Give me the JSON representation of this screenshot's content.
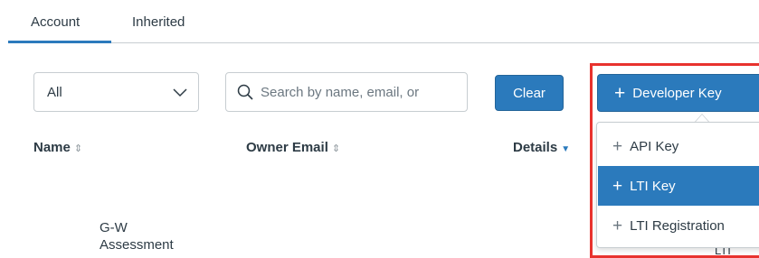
{
  "tabs": [
    {
      "label": "Account",
      "active": true
    },
    {
      "label": "Inherited",
      "active": false
    }
  ],
  "filter": {
    "selected": "All"
  },
  "search": {
    "placeholder": "Search by name, email, or"
  },
  "buttons": {
    "clear": "Clear",
    "developer_key": "Developer Key"
  },
  "table": {
    "headers": {
      "name": "Name",
      "owner_email": "Owner Email",
      "details": "Details"
    },
    "sort_glyph": "⇕",
    "active_sort_glyph": "▼",
    "row1": {
      "name_line1": "G-W",
      "name_line2": "Assessment",
      "details_partial": "LTI"
    }
  },
  "menu": {
    "items": [
      {
        "label": "API Key",
        "active": false
      },
      {
        "label": "LTI Key",
        "active": true
      },
      {
        "label": "LTI Registration",
        "active": false
      }
    ]
  },
  "colors": {
    "accent": "#2b7abc",
    "highlight": "#e8322e",
    "text": "#2d3b45"
  }
}
